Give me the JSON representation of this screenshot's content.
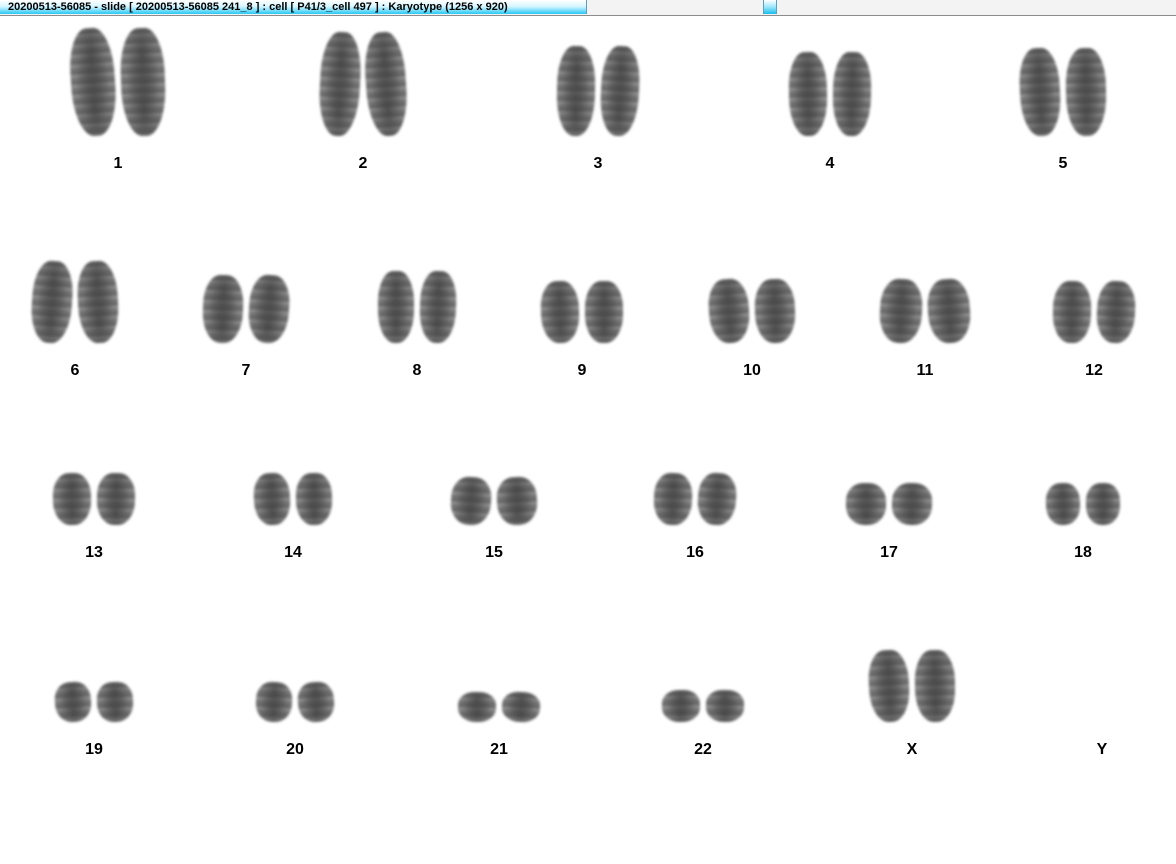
{
  "window": {
    "title": "20200513-56085 - slide [ 20200513-56085 241_8 ] : cell [ P41/3_cell 497 ] : Karyotype  (1256 x 920)"
  },
  "karyotype": {
    "chromosomes": [
      {
        "label": "1"
      },
      {
        "label": "2"
      },
      {
        "label": "3"
      },
      {
        "label": "4"
      },
      {
        "label": "5"
      },
      {
        "label": "6"
      },
      {
        "label": "7"
      },
      {
        "label": "8"
      },
      {
        "label": "9"
      },
      {
        "label": "10"
      },
      {
        "label": "11"
      },
      {
        "label": "12"
      },
      {
        "label": "13"
      },
      {
        "label": "14"
      },
      {
        "label": "15"
      },
      {
        "label": "16"
      },
      {
        "label": "17"
      },
      {
        "label": "18"
      },
      {
        "label": "19"
      },
      {
        "label": "20"
      },
      {
        "label": "21"
      },
      {
        "label": "22"
      },
      {
        "label": "X"
      },
      {
        "label": "Y"
      }
    ]
  }
}
